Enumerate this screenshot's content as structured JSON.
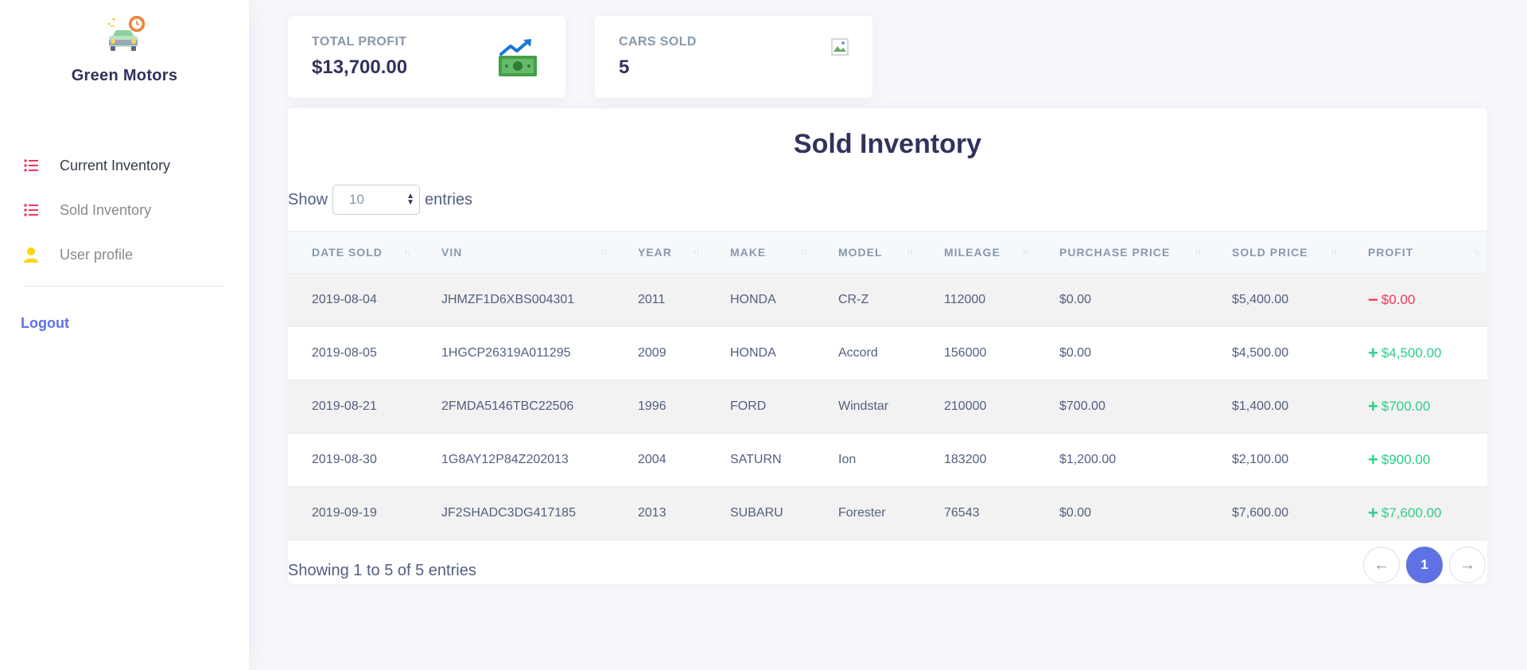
{
  "brand": {
    "name": "Green Motors"
  },
  "sidebar": {
    "items": [
      {
        "label": "Current Inventory",
        "icon": "list-icon",
        "active": true
      },
      {
        "label": "Sold Inventory",
        "icon": "list-icon",
        "active": false
      },
      {
        "label": "User profile",
        "icon": "user-icon",
        "active": false
      }
    ],
    "logout": "Logout"
  },
  "stats": {
    "profit": {
      "label": "TOTAL PROFIT",
      "value": "$13,700.00",
      "icon": "money-chart-icon"
    },
    "cars_sold": {
      "label": "CARS SOLD",
      "value": "5",
      "icon": "broken-image-icon"
    }
  },
  "table": {
    "title": "Sold Inventory",
    "show_label": "Show",
    "entries_label": "entries",
    "page_length": "10",
    "columns": [
      "DATE SOLD",
      "VIN",
      "YEAR",
      "MAKE",
      "MODEL",
      "MILEAGE",
      "PURCHASE PRICE",
      "SOLD PRICE",
      "PROFIT"
    ],
    "rows": [
      {
        "date": "2019-08-04",
        "vin": "JHMZF1D6XBS004301",
        "year": "2011",
        "make": "HONDA",
        "model": "CR-Z",
        "mileage": "112000",
        "purchase": "$0.00",
        "sold": "$5,400.00",
        "profit": "$0.00",
        "profit_sign": "−",
        "profit_status": "neg"
      },
      {
        "date": "2019-08-05",
        "vin": "1HGCP26319A011295",
        "year": "2009",
        "make": "HONDA",
        "model": "Accord",
        "mileage": "156000",
        "purchase": "$0.00",
        "sold": "$4,500.00",
        "profit": "$4,500.00",
        "profit_sign": "+",
        "profit_status": "pos"
      },
      {
        "date": "2019-08-21",
        "vin": "2FMDA5146TBC22506",
        "year": "1996",
        "make": "FORD",
        "model": "Windstar",
        "mileage": "210000",
        "purchase": "$700.00",
        "sold": "$1,400.00",
        "profit": "$700.00",
        "profit_sign": "+",
        "profit_status": "pos"
      },
      {
        "date": "2019-08-30",
        "vin": "1G8AY12P84Z202013",
        "year": "2004",
        "make": "SATURN",
        "model": "Ion",
        "mileage": "183200",
        "purchase": "$1,200.00",
        "sold": "$2,100.00",
        "profit": "$900.00",
        "profit_sign": "+",
        "profit_status": "pos"
      },
      {
        "date": "2019-09-19",
        "vin": "JF2SHADC3DG417185",
        "year": "2013",
        "make": "SUBARU",
        "model": "Forester",
        "mileage": "76543",
        "purchase": "$0.00",
        "sold": "$7,600.00",
        "profit": "$7,600.00",
        "profit_sign": "+",
        "profit_status": "pos"
      }
    ],
    "info": "Showing 1 to 5 of 5 entries",
    "pagination": {
      "prev": "←",
      "current": "1",
      "next": "→"
    }
  },
  "colors": {
    "accent": "#5e72e4",
    "positive": "#2dce89",
    "negative": "#f5365c",
    "nav_icon": "#f5365c",
    "user_icon": "#ffd600"
  }
}
